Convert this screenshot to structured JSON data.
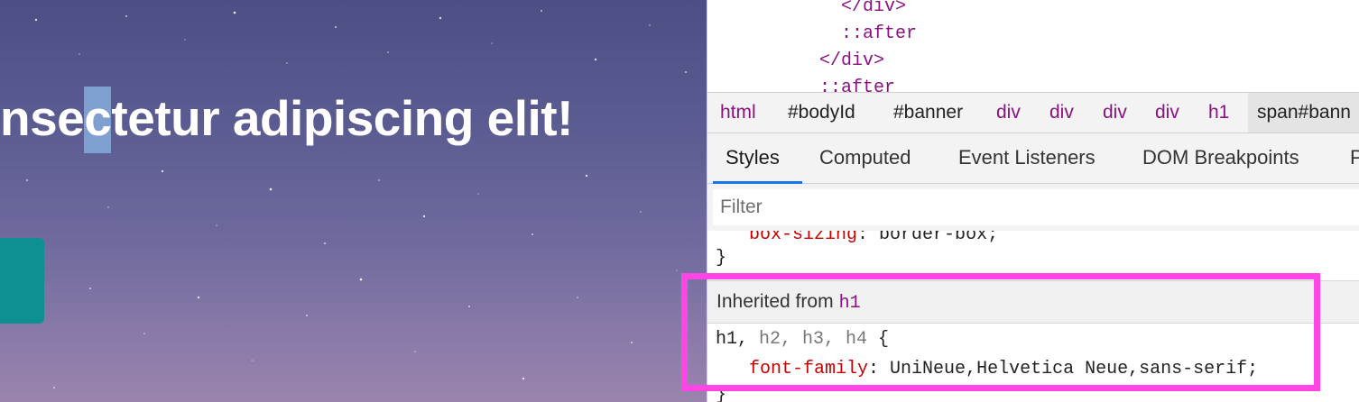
{
  "preview": {
    "headline_before": "nse",
    "headline_selected": "c",
    "headline_after": "tetur adipiscing elit!"
  },
  "dom_tree": {
    "line1": "</div>",
    "line2": "::after",
    "line3": "</div>",
    "line4": "::after"
  },
  "breadcrumbs": [
    "html",
    "#bodyId",
    "#banner",
    "div",
    "div",
    "div",
    "div",
    "h1",
    "span#bann"
  ],
  "tabs": [
    "Styles",
    "Computed",
    "Event Listeners",
    "DOM Breakpoints",
    "P"
  ],
  "filter": {
    "placeholder": "Filter"
  },
  "rules": {
    "prev_prop": "box-sizing",
    "prev_val": "border-box;",
    "close_brace": "}",
    "inherited_label": "Inherited from",
    "inherited_tag": "h1",
    "selector_first": "h1,",
    "selector_rest": " h2, h3, h4",
    "open_brace": " {",
    "prop": "font-family",
    "val": "UniNeue,Helvetica Neue,sans-serif;",
    "end_brace": "}"
  },
  "colors": {
    "highlight": "#ff45e6",
    "teal_button": "#0e8f92",
    "tab_accent": "#1a73e8",
    "tag_purple": "#881280",
    "prop_red": "#c80000"
  }
}
